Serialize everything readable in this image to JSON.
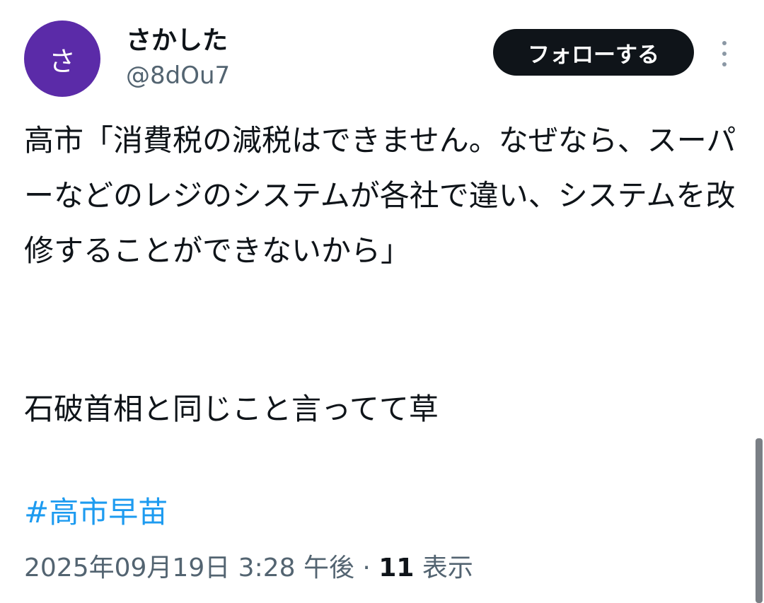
{
  "author": {
    "avatar_letter": "さ",
    "avatar_color": "#5b2ba8",
    "display_name": "さかした",
    "handle": "@8dOu7"
  },
  "follow_label": "フォローする",
  "more_icon": "more-vertical-icon",
  "tweet": {
    "text": "高市「消費税の減税はできません。なぜなら、スーパーなどのレジのシステムが各社で違い、システムを改修することができないから」",
    "text2": "石破首相と同じこと言ってて草",
    "hashtag": "#高市早苗"
  },
  "meta": {
    "timestamp": "2025年09月19日 3:28 午後",
    "separator": "·",
    "views_count": "11",
    "views_label": "表示"
  },
  "colors": {
    "link": "#1d9bf0",
    "secondary_text": "#536471",
    "button_bg": "#0f1419"
  }
}
